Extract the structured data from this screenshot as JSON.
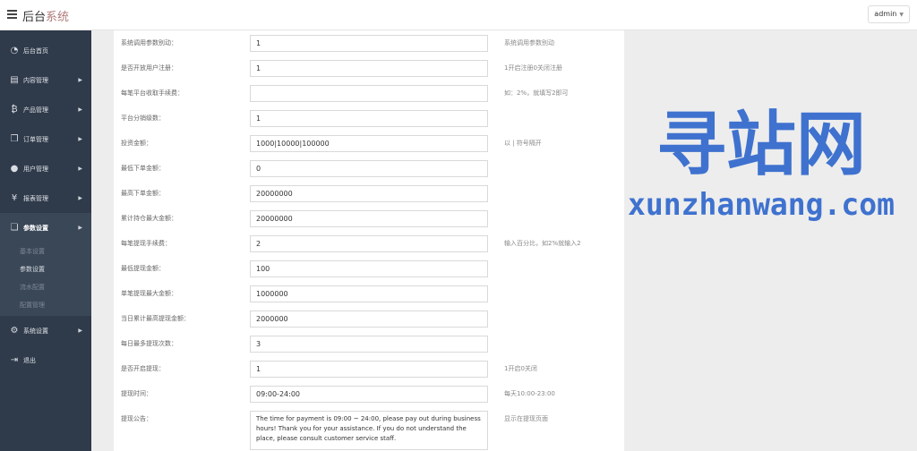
{
  "header": {
    "brand_main": "后台",
    "brand_accent": "系统",
    "user": "admin"
  },
  "sidebar": {
    "items": [
      {
        "label": "后台首页",
        "icon": "dashboard-icon"
      },
      {
        "label": "内容管理",
        "icon": "book-icon"
      },
      {
        "label": "产品管理",
        "icon": "bitcoin-icon"
      },
      {
        "label": "订单管理",
        "icon": "copy-icon"
      },
      {
        "label": "用户管理",
        "icon": "user-icon"
      },
      {
        "label": "报表管理",
        "icon": "yen-icon"
      },
      {
        "label": "参数设置",
        "icon": "files-icon"
      },
      {
        "label": "系统设置",
        "icon": "cogs-icon"
      },
      {
        "label": "退出",
        "icon": "sign-out-icon"
      }
    ],
    "submenu": [
      "基本设置",
      "参数设置",
      "流水配置",
      "配置管理"
    ]
  },
  "form": {
    "rows": [
      {
        "label": "系统调用参数别动：",
        "value": "1",
        "hint": "系统调用参数别动"
      },
      {
        "label": "是否开放用户注册：",
        "value": "1",
        "hint": "1开启注册0关闭注册"
      },
      {
        "label": "每笔平台收取手续费：",
        "value": "",
        "hint": "如：2%，就填写2即可"
      },
      {
        "label": "平台分销级数：",
        "value": "1",
        "hint": ""
      },
      {
        "label": "投资金额：",
        "value": "1000|10000|100000",
        "hint": "以 | 符号隔开"
      },
      {
        "label": "最低下单金额：",
        "value": "0",
        "hint": ""
      },
      {
        "label": "最高下单金额：",
        "value": "20000000",
        "hint": ""
      },
      {
        "label": "累计持仓最大金额：",
        "value": "20000000",
        "hint": ""
      },
      {
        "label": "每笔提现手续费：",
        "value": "2",
        "hint": "输入百分比，如2%就输入2"
      },
      {
        "label": "最低提现金额：",
        "value": "100",
        "hint": ""
      },
      {
        "label": "单笔提现最大金额：",
        "value": "1000000",
        "hint": ""
      },
      {
        "label": "当日累计最高提现金额：",
        "value": "2000000",
        "hint": ""
      },
      {
        "label": "每日最多提现次数：",
        "value": "3",
        "hint": ""
      },
      {
        "label": "是否开启提现：",
        "value": "1",
        "hint": "1开启0关闭"
      },
      {
        "label": "提现时间：",
        "value": "09:00-24:00",
        "hint": "每天10:00-23:00"
      },
      {
        "label": "提现公告：",
        "value": "The time for payment is 09:00 ~ 24:00, please pay out during business hours! Thank you for your assistance. If you do not understand the place, please consult customer service staff.",
        "hint": "显示在提现页面"
      }
    ]
  },
  "watermark": {
    "title": "寻站网",
    "url": "xunzhanwang.com",
    "color": "#3f72cf"
  }
}
